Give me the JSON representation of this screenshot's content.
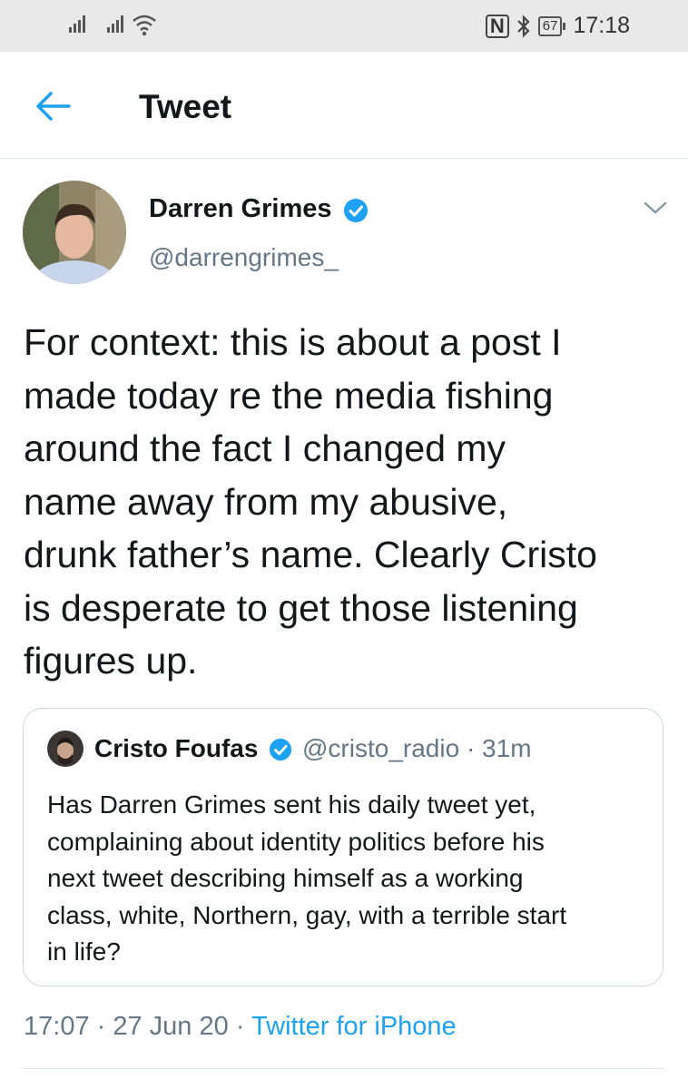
{
  "status_bar": {
    "nfc_label": "N",
    "battery": "67",
    "time": "17:18"
  },
  "header": {
    "back_icon": "arrow-left-icon",
    "title": "Tweet"
  },
  "tweet": {
    "author_name": "Darren Grimes",
    "author_handle": "@darrengrimes_",
    "verified_icon": "verified-badge-icon",
    "text": "For context: this is about a post I\nmade today re the media fishing\naround the fact I changed my\nname away from my abusive,\ndrunk father’s name. Clearly Cristo\nis desperate to get those listening\nfigures up.",
    "time": "17:07",
    "date": "27 Jun 20",
    "source": "Twitter for iPhone"
  },
  "quoted_tweet": {
    "author_name": "Cristo Foufas",
    "author_handle": "@cristo_radio",
    "age": "31m",
    "text": "Has Darren Grimes sent his daily tweet yet,\ncomplaining about identity politics before his\nnext tweet describing himself as a working\nclass,  white, Northern, gay, with a terrible start\nin life?"
  },
  "colors": {
    "accent": "#1da1f2",
    "secondary_text": "#657786",
    "primary_text": "#14171a",
    "status_bar_bg": "#e9e9e9"
  }
}
